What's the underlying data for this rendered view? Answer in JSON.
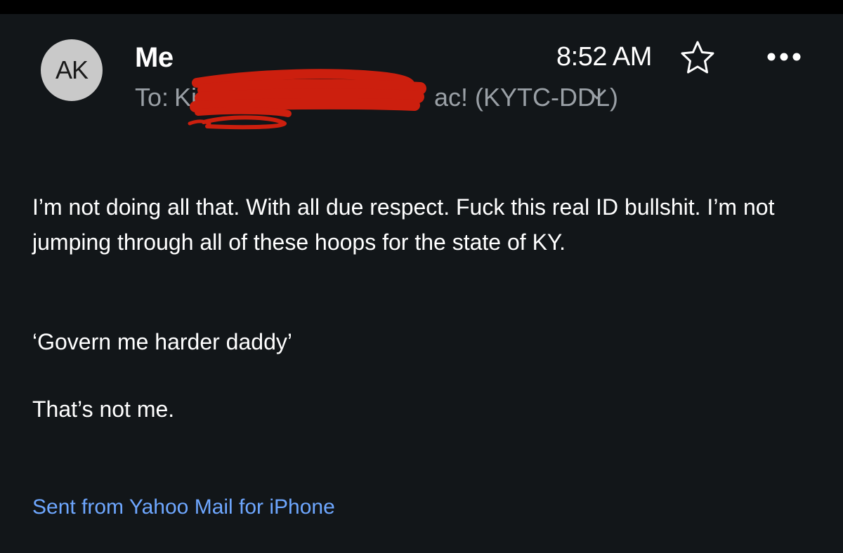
{
  "header": {
    "avatar_initials": "AK",
    "sender_name": "Me",
    "time": "8:52 AM",
    "to_label": "To:",
    "recipient_visible_start": "Ki",
    "recipient_visible_end": "ac! (KYTC-DDL)",
    "icons": {
      "star": "star-outline-icon",
      "more": "more-horizontal-icon",
      "expand": "chevron-down-icon"
    }
  },
  "message": {
    "paragraphs": [
      "I’m not doing all that. With all due respect. Fuck this real ID bullshit. I’m not jumping through all of these hoops for the state of KY.",
      "‘Govern me harder daddy’",
      "That’s not me."
    ],
    "signature": "Sent from Yahoo Mail for iPhone"
  },
  "colors": {
    "background": "#121619",
    "text": "#ffffff",
    "secondary_text": "#9aa0a6",
    "link": "#6ea7ff",
    "redaction": "#cc1f0e"
  }
}
